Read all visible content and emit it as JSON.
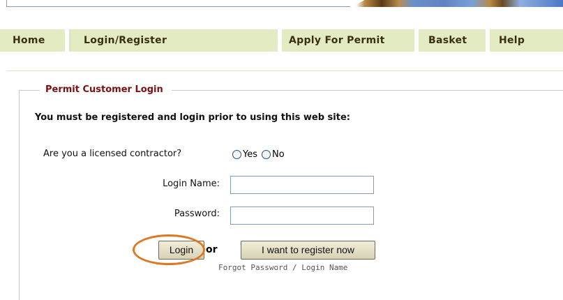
{
  "nav": {
    "tabs": [
      {
        "label": "Home"
      },
      {
        "label": "Login/Register"
      },
      {
        "label": "Apply For Permit"
      },
      {
        "label": "Basket"
      },
      {
        "label": "Help"
      }
    ]
  },
  "login": {
    "legend": "Permit Customer Login",
    "instruction": "You must be registered and login prior to using this web site:",
    "contractor_question": "Are you a licensed contractor?",
    "radio_yes": "Yes",
    "radio_no": "No",
    "login_name_label": "Login Name:",
    "login_name_value": "",
    "password_label": "Password:",
    "password_value": "",
    "login_button": "Login",
    "or_text": "or",
    "register_button": "I want to register now",
    "forgot_link": "Forgot Password / Login Name"
  },
  "colors": {
    "nav_bg": "#e2ebc1",
    "legend_text": "#7a1010",
    "highlight": "#e07823"
  }
}
